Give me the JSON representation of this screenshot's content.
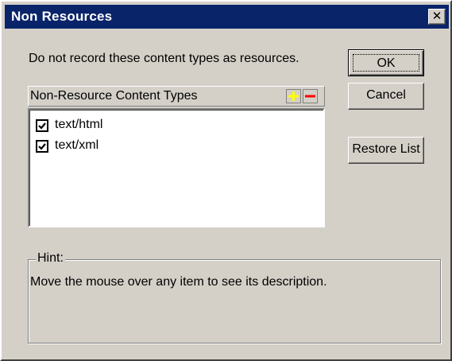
{
  "dialog": {
    "title": "Non Resources",
    "close_glyph": "✕",
    "description": "Do not record these content types as resources."
  },
  "buttons": {
    "ok": "OK",
    "cancel": "Cancel",
    "restore": "Restore List"
  },
  "list": {
    "header": "Non-Resource Content Types",
    "add_icon": "plus-icon",
    "remove_icon": "minus-icon",
    "items": [
      {
        "label": "text/html",
        "checked": true
      },
      {
        "label": "text/xml",
        "checked": true
      }
    ]
  },
  "hint": {
    "legend": "Hint:",
    "text": "Move the mouse over any item to see its description."
  },
  "colors": {
    "titlebar": "#0a246a",
    "face": "#d4d0c8",
    "add_icon": "#ffff00",
    "remove_icon": "#ff0000"
  }
}
